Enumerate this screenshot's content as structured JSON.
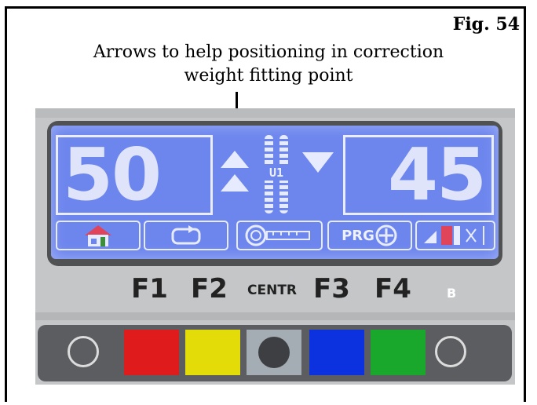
{
  "figure": {
    "label": "Fig. 54",
    "caption_line1": "Arrows to help positioning in correction",
    "caption_line2": "weight fitting point"
  },
  "display": {
    "left_value": "50",
    "right_value": "45",
    "plane_label": "U1",
    "function_icons": [
      "home-icon",
      "repeat-icon",
      "measure-icon",
      "program-icon",
      "tyre-settings-icon"
    ],
    "program_label": "PRG"
  },
  "keys": {
    "f1": "F1",
    "f2": "F2",
    "centr": "CENTR",
    "f3": "F3",
    "f4": "F4",
    "b": "B"
  },
  "keypad": {
    "buttons": [
      "left-round",
      "red",
      "yellow",
      "centre-grey",
      "blue",
      "green",
      "right-round"
    ],
    "colors": {
      "red": "#e01b1b",
      "yellow": "#e3dc09",
      "grey": "#a4acb4",
      "blue": "#0c32e0",
      "green": "#1aa82c"
    }
  },
  "colors": {
    "lcd_background": "#6d86ee",
    "lcd_foreground": "#e6ebff"
  }
}
